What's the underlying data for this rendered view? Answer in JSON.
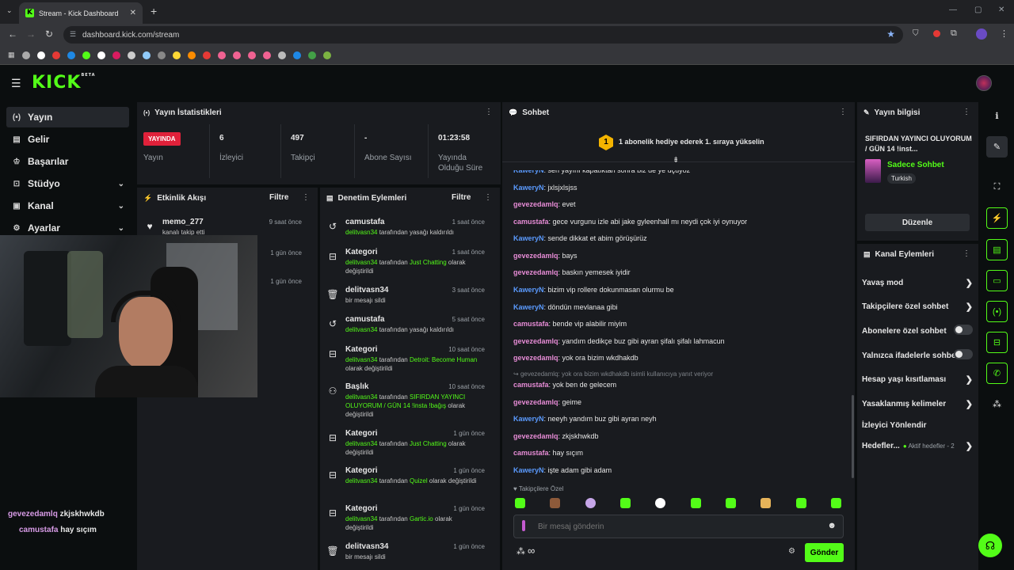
{
  "browser": {
    "tab_title": "Stream - Kick Dashboard",
    "url": "dashboard.kick.com/stream"
  },
  "brand": {
    "logo": "KICK",
    "logo_sup": "BETA",
    "accent": "#53fc18"
  },
  "sidebar": {
    "items": [
      {
        "label": "Yayın",
        "icon": "broadcast-icon"
      },
      {
        "label": "Gelir",
        "icon": "revenue-icon"
      },
      {
        "label": "Başarılar",
        "icon": "trophy-icon"
      },
      {
        "label": "Stüdyo",
        "icon": "studio-icon"
      },
      {
        "label": "Kanal",
        "icon": "channel-icon"
      },
      {
        "label": "Ayarlar",
        "icon": "gear-icon"
      }
    ]
  },
  "stats": {
    "title": "Yayın İstatistikleri",
    "live_badge": "YAYINDA",
    "live_label": "Yayın",
    "viewers": {
      "value": "6",
      "label": "İzleyici"
    },
    "followers": {
      "value": "497",
      "label": "Takipçi"
    },
    "subs": {
      "value": "-",
      "label": "Abone Sayısı"
    },
    "duration": {
      "value": "01:23:58",
      "label": "Yayında Olduğu Süre"
    }
  },
  "activity": {
    "title": "Etkinlik Akışı",
    "filter": "Filtre",
    "items": [
      {
        "name": "memo_277",
        "desc": "kanalı takip etti",
        "time": "9 saat önce"
      },
      {
        "time": "1 gün önce"
      },
      {
        "time": "1 gün önce"
      }
    ]
  },
  "moderation": {
    "title": "Denetim Eylemleri",
    "filter": "Filtre",
    "items": [
      {
        "title": "camustafa",
        "time": "1 saat önce",
        "p1": "delitvasn34",
        "p2": " tarafından yasağı kaldırıldı",
        "p3": "",
        "p4": ""
      },
      {
        "title": "Kategori",
        "time": "1 saat önce",
        "p1": "delitvasn34",
        "p2": " tarafından ",
        "p3": "Just Chatting",
        "p4": " olarak değiştirildi"
      },
      {
        "title": "delitvasn34",
        "time": "3 saat önce",
        "p1": "",
        "p2": "bir mesajı sildi",
        "p3": "",
        "p4": ""
      },
      {
        "title": "camustafa",
        "time": "5 saat önce",
        "p1": "delitvasn34",
        "p2": " tarafından yasağı kaldırıldı",
        "p3": "",
        "p4": ""
      },
      {
        "title": "Kategori",
        "time": "10 saat önce",
        "p1": "delitvasn34",
        "p2": " tarafından ",
        "p3": "Detroit: Become Human",
        "p4": " olarak değiştirildi"
      },
      {
        "title": "Başlık",
        "time": "10 saat önce",
        "p1": "delitvasn34",
        "p2": " tarafından ",
        "p3": "SIFIRDAN YAYINCI OLUYORUM / GÜN 14 !insta !bağış",
        "p4": " olarak değiştirildi"
      },
      {
        "title": "Kategori",
        "time": "1 gün önce",
        "p1": "delitvasn34",
        "p2": " tarafından ",
        "p3": "Just Chatting",
        "p4": " olarak değiştirildi"
      },
      {
        "title": "Kategori",
        "time": "1 gün önce",
        "p1": "delitvasn34",
        "p2": " tarafından ",
        "p3": "Quizel",
        "p4": " olarak değiştirildi"
      },
      {
        "title": "Kategori",
        "time": "1 gün önce",
        "p1": "delitvasn34",
        "p2": " tarafından ",
        "p3": "Gartic.io",
        "p4": " olarak değiştirildi"
      },
      {
        "title": "delitvasn34",
        "time": "1 gün önce",
        "p1": "",
        "p2": "bir mesajı sildi",
        "p3": "",
        "p4": ""
      }
    ]
  },
  "chat": {
    "title": "Sohbet",
    "gift_num": "1",
    "gift_banner": "1 abonelik hediye ederek 1. sıraya yükselin",
    "messages": [
      {
        "user": "KaweryN",
        "text": "sen yayını kapatıktan sonra biz de ye uçuyoz"
      },
      {
        "user": "KaweryN",
        "text": "jxlsjxlsjss"
      },
      {
        "user": "gevezedamlq",
        "text": "evet"
      },
      {
        "user": "camustafa",
        "text": "gece vurgunu izle abi jake gyleenhall mı neydi çok iyi oynuyor"
      },
      {
        "user": "KaweryN",
        "text": "sende dikkat et abim görüşürüz"
      },
      {
        "user": "gevezedamlq",
        "text": "bays"
      },
      {
        "user": "gevezedamlq",
        "text": "baskın yemesek iyidir"
      },
      {
        "user": "KaweryN",
        "text": "bizim vip rollere dokunmasan olurmu be"
      },
      {
        "user": "KaweryN",
        "text": "döndün mevlanaa gibi"
      },
      {
        "user": "camustafa",
        "text": "bende vip alabilir miyim"
      },
      {
        "user": "gevezedamlq",
        "text": "yandım dedikçe buz gibi ayran şifalı şifalı lahmacun"
      },
      {
        "user": "gevezedamlq",
        "text": "yok ora bizim wkdhakdb"
      },
      {
        "user": "camustafa",
        "text": "yok ben de gelecem"
      },
      {
        "user": "gevezedamlq",
        "text": "geime"
      },
      {
        "user": "KaweryN",
        "text": "neeyh yandım buz gibi ayran neyh"
      },
      {
        "user": "gevezedamlq",
        "text": "zkjskhwkdb"
      },
      {
        "user": "camustafa",
        "text": "hay sıçım"
      },
      {
        "user": "KaweryN",
        "text": "işte adam gibi adam"
      }
    ],
    "reply_note": "gevezedamlq: yok ora bizim wkdhakdb isimli kullanıcıya yanıt veriyor",
    "followers_only": "Takipçilere Özel",
    "placeholder": "Bir mesaj gönderin",
    "send": "Gönder",
    "infinity": "∞"
  },
  "stream_info": {
    "title": "Yayın bilgisi",
    "stream_title": "SIFIRDAN YAYINCI OLUYORUM / GÜN 14 !inst...",
    "category": "Sadece Sohbet",
    "language": "Turkish",
    "edit": "Düzenle"
  },
  "channel_actions": {
    "title": "Kanal Eylemleri",
    "items": [
      {
        "label": "Yavaş mod"
      },
      {
        "label": "Takipçilere özel sohbet"
      },
      {
        "label": "Abonelere özel sohbet"
      },
      {
        "label": "Yalnızca ifadelerle sohbet"
      },
      {
        "label": "Hesap yaşı kısıtlaması"
      },
      {
        "label": "Yasaklanmış kelimeler"
      },
      {
        "label": "İzleyici Yönlendir"
      },
      {
        "label": "Hedefler..."
      }
    ],
    "goals_note": "Aktif hedefler - 2"
  },
  "overlay_chat": [
    {
      "user": "gevezedamlq",
      "text": "zkjskhwkdb"
    },
    {
      "user": "camustafa",
      "text": "hay sıçım"
    }
  ]
}
